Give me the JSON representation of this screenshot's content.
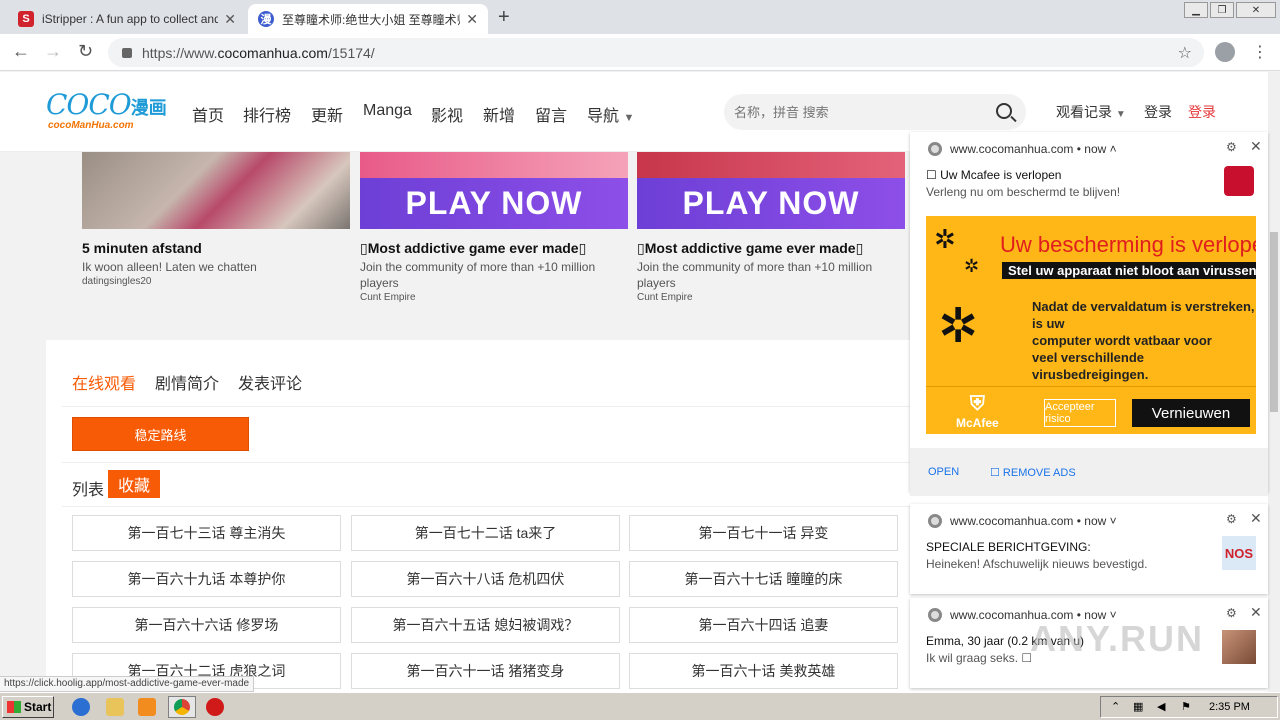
{
  "browser": {
    "tabs": [
      {
        "title": "iStripper : A fun app to collect and w",
        "favicon": "istripper-icon"
      },
      {
        "title": "至尊瞳术师:绝世大小姐 至尊瞳术师",
        "favicon": "cocomanhua-icon"
      }
    ],
    "url_prefix": "https://www.",
    "url_domain": "cocomanhua.com",
    "url_path": "/15174/"
  },
  "site": {
    "logo_big": "COCO",
    "logo_cn": "漫画",
    "logo_small": "cocoManHua.com",
    "nav": [
      "首页",
      "排行榜",
      "更新",
      "Manga",
      "影视",
      "新增",
      "留言",
      "导航"
    ],
    "search_placeholder": "名称，拼音 搜索",
    "history": "观看记录",
    "login": "登录",
    "register": "登录"
  },
  "ads": [
    {
      "title": "5 minuten afstand",
      "desc": "Ik woon alleen! Laten we chatten",
      "source": "datingsingles20",
      "play": ""
    },
    {
      "title": "Most addictive game ever made",
      "desc": "Join the community of more than +10 million players",
      "source": "Cunt Empire",
      "play": "PLAY NOW"
    },
    {
      "title": "Most addictive game ever made",
      "desc": "Join the community of more than +10 million players",
      "source": "Cunt Empire",
      "play": "PLAY NOW"
    }
  ],
  "content": {
    "tabs": [
      "在线观看",
      "剧情简介",
      "发表评论"
    ],
    "route_button": "稳定路线",
    "list_label": "列表",
    "favorite": "收藏",
    "episodes": [
      "第一百七十三话 尊主消失",
      "第一百七十二话 ta来了",
      "第一百七十一话 异变",
      "第一百六十九话 本尊护你",
      "第一百六十八话 危机四伏",
      "第一百六十七话 瞳瞳的床",
      "第一百六十六话 修罗场",
      "第一百六十五话 媳妇被调戏？",
      "第一百六十四话 追妻",
      "第一百六十二话 虎狼之词",
      "第一百六十一话 猪猪变身",
      "第一百六十话 美救英雄"
    ]
  },
  "notifications": [
    {
      "origin": "www.cocomanhua.com",
      "time": "now",
      "title": "☐ Uw Mcafee is verlopen",
      "body": "Verleng nu om beschermd te blijven!",
      "image": {
        "headline": "Uw bescherming is verlopen!",
        "sub": "Stel uw apparaat niet bloot aan virussen.",
        "lines": [
          "Nadat de vervaldatum is verstreken, is uw",
          "computer wordt vatbaar voor",
          "veel verschillende virusbedreigingen."
        ],
        "brand": "McAfee",
        "accept": "Accepteer risico",
        "renew": "Vernieuwen"
      },
      "actions": [
        "OPEN",
        "☐ REMOVE ADS"
      ]
    },
    {
      "origin": "www.cocomanhua.com",
      "time": "now",
      "title": "SPECIALE BERICHTGEVING:",
      "body": "Heineken! Afschuwelijk nieuws bevestigd.",
      "icon": "NOS"
    },
    {
      "origin": "www.cocomanhua.com",
      "time": "now",
      "title": "Emma, 30 jaar (0.2 km van u)",
      "body": "Ik wil graag seks. ☐"
    }
  ],
  "status_url": "https://click.hoolig.app/most-addictive-game-ever-made",
  "watermark": "ANY.RUN",
  "taskbar": {
    "start": "Start",
    "clock": "2:35 PM"
  },
  "colors": {
    "accent": "#f85b05",
    "brand": "#1e9bd7",
    "mcafee_red": "#e01e1e",
    "mcafee_yellow": "#ffb718"
  }
}
